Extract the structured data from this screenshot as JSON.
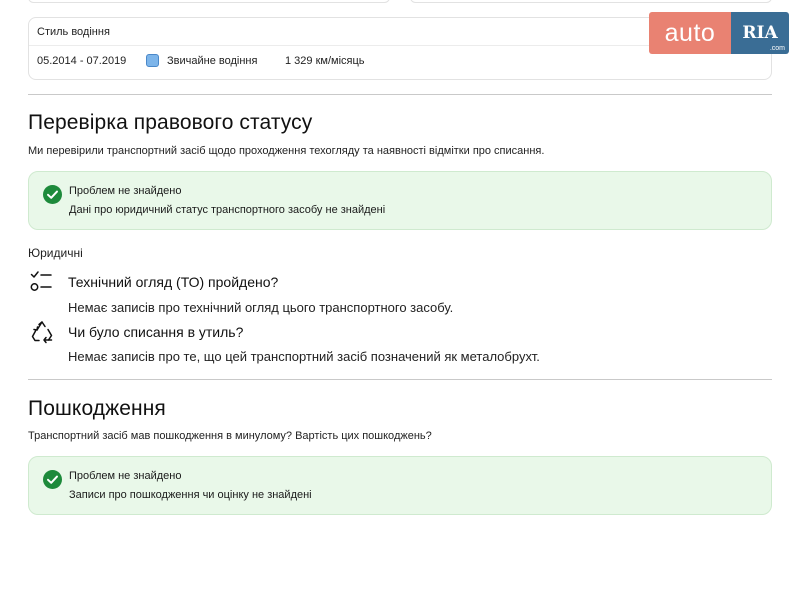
{
  "driving_style": {
    "title": "Стиль водіння",
    "period": "05.2014 - 07.2019",
    "type": "Звичайне водіння",
    "mileage": "1 329 км/місяць",
    "swatch_color": "#7db5ea"
  },
  "logo": {
    "auto": "auto",
    "ria": "RIA",
    "com": ".com"
  },
  "legal_status": {
    "heading": "Перевірка правового статусу",
    "lead": "Ми перевірили транспортний засіб щодо проходження техогляду та наявності відмітки про списання.",
    "result": {
      "title": "Проблем не знайдено",
      "detail": "Дані про юридичний статус транспортного засобу не знайдені"
    },
    "subheading": "Юридичні",
    "items": [
      {
        "icon": "checklist-icon",
        "question": "Технічний огляд (ТО) пройдено?",
        "answer": "Немає записів про технічний огляд цього транспортного засобу."
      },
      {
        "icon": "recycle-icon",
        "question": "Чи було списання в утиль?",
        "answer": "Немає записів про те, що цей транспортний засіб позначений як металобрухт."
      }
    ]
  },
  "damage": {
    "heading": "Пошкодження",
    "lead": "Транспортний засіб мав пошкодження в минулому? Вартість цих пошкоджень?",
    "result": {
      "title": "Проблем не знайдено",
      "detail": "Записи про пошкодження чи оцінку не знайдені"
    }
  },
  "colors": {
    "success_bg": "#e9f8e9",
    "success_icon": "#1d8a3b",
    "logo_auto": "#e98272",
    "logo_ria": "#3a6d95"
  }
}
